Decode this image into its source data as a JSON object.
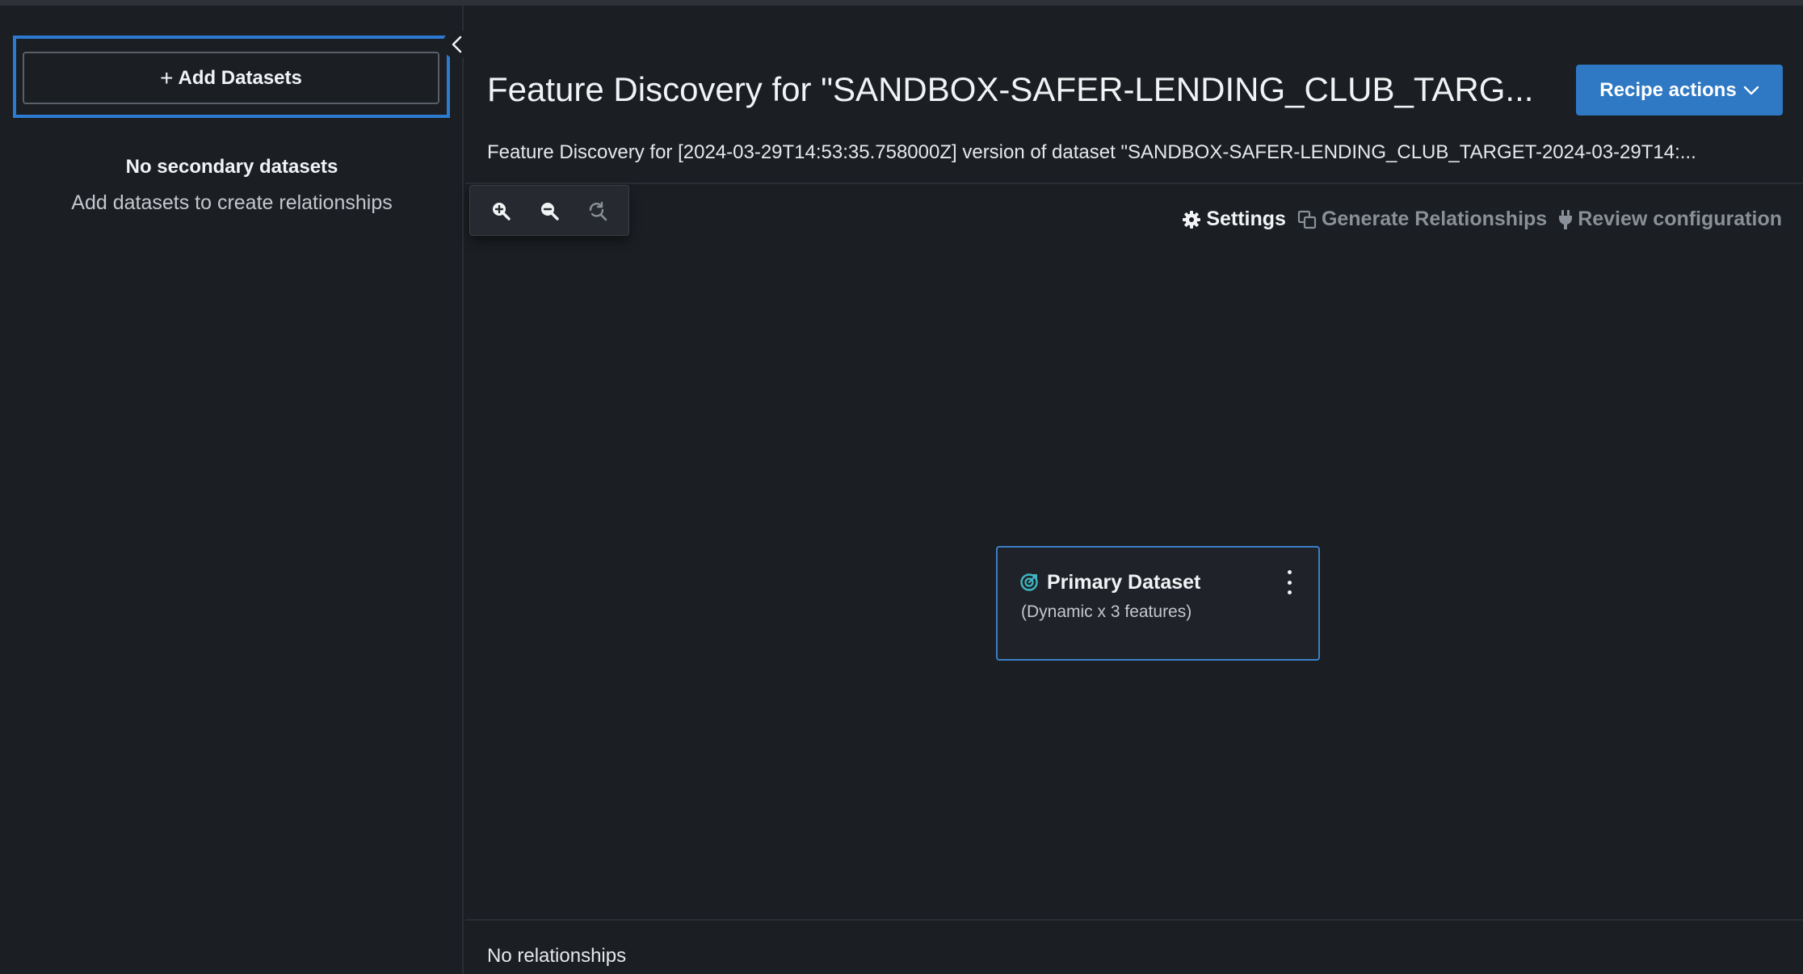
{
  "sidebar": {
    "add_button_plus": "+",
    "add_button_label": "Add Datasets",
    "empty_title": "No secondary datasets",
    "empty_subtitle": "Add datasets to create relationships",
    "collapse_icon": "chevron-left-icon"
  },
  "header": {
    "title": "Feature Discovery for \"SANDBOX-SAFER-LENDING_CLUB_TARG...",
    "subtitle": "Feature Discovery for [2024-03-29T14:53:35.758000Z] version of dataset \"SANDBOX-SAFER-LENDING_CLUB_TARGET-2024-03-29T14:...",
    "recipe_actions_label": "Recipe actions"
  },
  "toolbar": {
    "settings_label": "Settings",
    "generate_label": "Generate Relationships",
    "review_label": "Review configuration"
  },
  "zoom": {
    "zoom_in_icon": "zoom-in-icon",
    "zoom_out_icon": "zoom-out-icon",
    "reset_icon": "reset-zoom-icon"
  },
  "node": {
    "title": "Primary Dataset",
    "subtitle": "(Dynamic x 3 features)",
    "icon": "target-icon",
    "menu_icon": "more-vertical-icon"
  },
  "footer": {
    "relationships_status": "No relationships"
  },
  "colors": {
    "background": "#1b1e23",
    "accent": "#2e78c4",
    "focus_outline": "#2d7bd0",
    "node_icon": "#3fb7c4",
    "disabled_text": "#8a9098"
  }
}
